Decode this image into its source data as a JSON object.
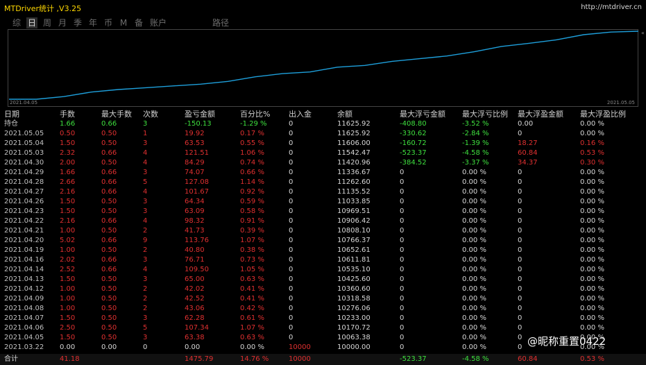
{
  "window": {
    "title": "MTDriver统计 ,V3.25",
    "url": "http://mtdriver.cn"
  },
  "tabs": [
    "综",
    "日",
    "周",
    "月",
    "季",
    "年",
    "币",
    "M",
    "备",
    "账户",
    "路径"
  ],
  "active_tab": 1,
  "chart": {
    "start_label": "2021.04.05",
    "end_label": "2021.05.05",
    "collapse_icon": "«",
    "line_color": "#1ea0dc"
  },
  "headers": [
    "日期",
    "手数",
    "最大手数",
    "次数",
    "盈亏金额",
    "百分比%",
    "出入金",
    "余额",
    "最大浮亏金额",
    "最大浮亏比例",
    "最大浮盈金额",
    "最大浮盈比例"
  ],
  "rows": [
    [
      "持仓",
      "1.66",
      "0.66",
      "3",
      "-150.13",
      "-1.29 %",
      "0",
      "11625.92",
      "-408.80",
      "-3.52 %",
      "0.00",
      "0.00 %"
    ],
    [
      "2021.05.05",
      "0.50",
      "0.50",
      "1",
      "19.92",
      "0.17 %",
      "0",
      "11625.92",
      "-330.62",
      "-2.84 %",
      "0",
      "0.00 %"
    ],
    [
      "2021.05.04",
      "1.50",
      "0.50",
      "3",
      "63.53",
      "0.55 %",
      "0",
      "11606.00",
      "-160.72",
      "-1.39 %",
      "18.27",
      "0.16 %"
    ],
    [
      "2021.05.03",
      "2.32",
      "0.66",
      "4",
      "121.51",
      "1.06 %",
      "0",
      "11542.47",
      "-523.37",
      "-4.58 %",
      "60.84",
      "0.53 %"
    ],
    [
      "2021.04.30",
      "2.00",
      "0.50",
      "4",
      "84.29",
      "0.74 %",
      "0",
      "11420.96",
      "-384.52",
      "-3.37 %",
      "34.37",
      "0.30 %"
    ],
    [
      "2021.04.29",
      "1.66",
      "0.66",
      "3",
      "74.07",
      "0.66 %",
      "0",
      "11336.67",
      "0",
      "0.00 %",
      "0",
      "0.00 %"
    ],
    [
      "2021.04.28",
      "2.66",
      "0.66",
      "5",
      "127.08",
      "1.14 %",
      "0",
      "11262.60",
      "0",
      "0.00 %",
      "0",
      "0.00 %"
    ],
    [
      "2021.04.27",
      "2.16",
      "0.66",
      "4",
      "101.67",
      "0.92 %",
      "0",
      "11135.52",
      "0",
      "0.00 %",
      "0",
      "0.00 %"
    ],
    [
      "2021.04.26",
      "1.50",
      "0.50",
      "3",
      "64.34",
      "0.59 %",
      "0",
      "11033.85",
      "0",
      "0.00 %",
      "0",
      "0.00 %"
    ],
    [
      "2021.04.23",
      "1.50",
      "0.50",
      "3",
      "63.09",
      "0.58 %",
      "0",
      "10969.51",
      "0",
      "0.00 %",
      "0",
      "0.00 %"
    ],
    [
      "2021.04.22",
      "2.16",
      "0.66",
      "4",
      "98.32",
      "0.91 %",
      "0",
      "10906.42",
      "0",
      "0.00 %",
      "0",
      "0.00 %"
    ],
    [
      "2021.04.21",
      "1.00",
      "0.50",
      "2",
      "41.73",
      "0.39 %",
      "0",
      "10808.10",
      "0",
      "0.00 %",
      "0",
      "0.00 %"
    ],
    [
      "2021.04.20",
      "5.02",
      "0.66",
      "9",
      "113.76",
      "1.07 %",
      "0",
      "10766.37",
      "0",
      "0.00 %",
      "0",
      "0.00 %"
    ],
    [
      "2021.04.19",
      "1.00",
      "0.50",
      "2",
      "40.80",
      "0.38 %",
      "0",
      "10652.61",
      "0",
      "0.00 %",
      "0",
      "0.00 %"
    ],
    [
      "2021.04.16",
      "2.02",
      "0.66",
      "3",
      "76.71",
      "0.73 %",
      "0",
      "10611.81",
      "0",
      "0.00 %",
      "0",
      "0.00 %"
    ],
    [
      "2021.04.14",
      "2.52",
      "0.66",
      "4",
      "109.50",
      "1.05 %",
      "0",
      "10535.10",
      "0",
      "0.00 %",
      "0",
      "0.00 %"
    ],
    [
      "2021.04.13",
      "1.50",
      "0.50",
      "3",
      "65.00",
      "0.63 %",
      "0",
      "10425.60",
      "0",
      "0.00 %",
      "0",
      "0.00 %"
    ],
    [
      "2021.04.12",
      "1.00",
      "0.50",
      "2",
      "42.02",
      "0.41 %",
      "0",
      "10360.60",
      "0",
      "0.00 %",
      "0",
      "0.00 %"
    ],
    [
      "2021.04.09",
      "1.00",
      "0.50",
      "2",
      "42.52",
      "0.41 %",
      "0",
      "10318.58",
      "0",
      "0.00 %",
      "0",
      "0.00 %"
    ],
    [
      "2021.04.08",
      "1.00",
      "0.50",
      "2",
      "43.06",
      "0.42 %",
      "0",
      "10276.06",
      "0",
      "0.00 %",
      "0",
      "0.00 %"
    ],
    [
      "2021.04.07",
      "1.50",
      "0.50",
      "3",
      "62.28",
      "0.61 %",
      "0",
      "10233.00",
      "0",
      "0.00 %",
      "0",
      "0.00 %"
    ],
    [
      "2021.04.06",
      "2.50",
      "0.50",
      "5",
      "107.34",
      "1.07 %",
      "0",
      "10170.72",
      "0",
      "0.00 %",
      "0",
      "0.00 %"
    ],
    [
      "2021.04.05",
      "1.50",
      "0.50",
      "3",
      "63.38",
      "0.63 %",
      "0",
      "10063.38",
      "0",
      "0.00 %",
      "0",
      "0.00 %"
    ],
    [
      "2021.03.22",
      "0.00",
      "0.00",
      "0",
      "0.00",
      "0.00 %",
      "10000",
      "10000.00",
      "0",
      "0.00 %",
      "0",
      "0.00 %"
    ]
  ],
  "total": [
    "合计",
    "41.18",
    "",
    "",
    "1475.79",
    "14.76 %",
    "10000",
    "",
    "-523.37",
    "-4.58 %",
    "60.84",
    "0.53 %"
  ],
  "watermark": "@昵称重置0422",
  "colors": {
    "loss": "#3ee03e",
    "profit": "#e03030",
    "title": "#ffd800"
  }
}
